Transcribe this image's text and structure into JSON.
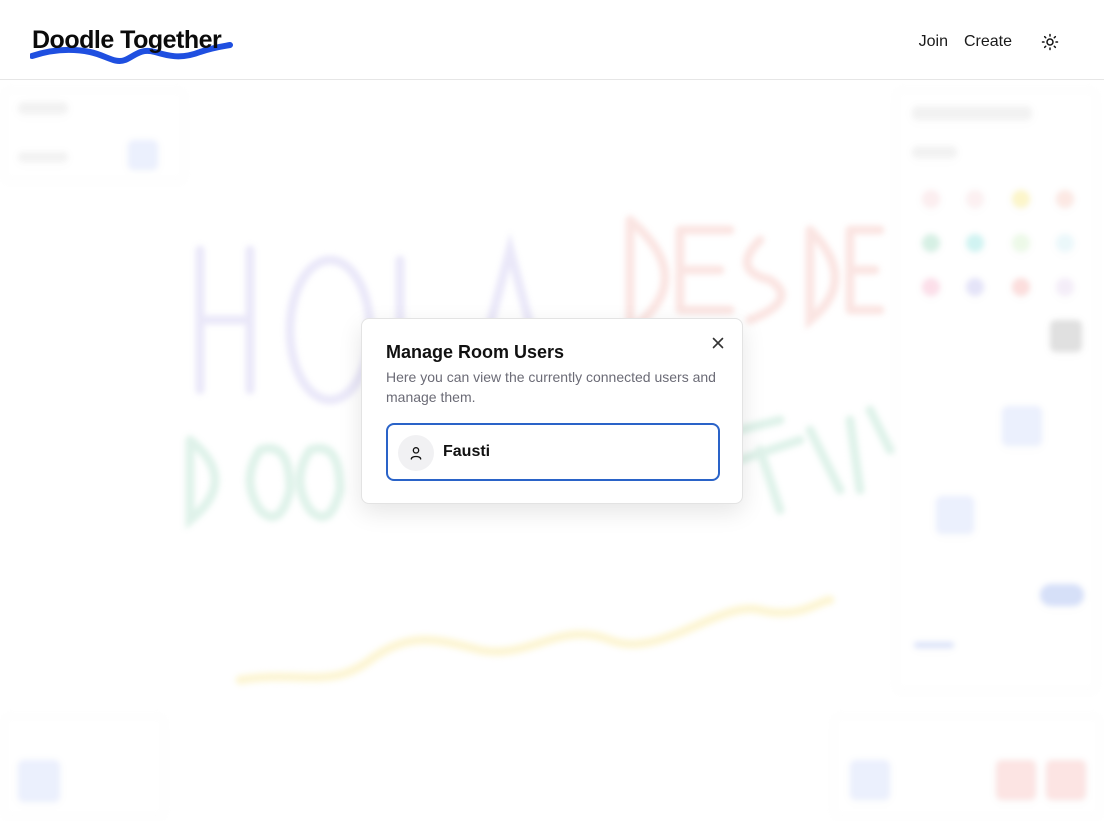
{
  "app": {
    "title": "Doodle Together"
  },
  "header": {
    "nav": [
      {
        "label": "Join"
      },
      {
        "label": "Create"
      }
    ],
    "theme_icon": "sun-icon",
    "accent_color": "#1f4fe0"
  },
  "dialog": {
    "title": "Manage Room Users",
    "description": "Here you can view the currently connected users and manage them.",
    "close_icon": "close-icon",
    "users": [
      {
        "name": "Fausti",
        "icon": "user-icon"
      }
    ],
    "selected_border_color": "#2a63c8"
  }
}
